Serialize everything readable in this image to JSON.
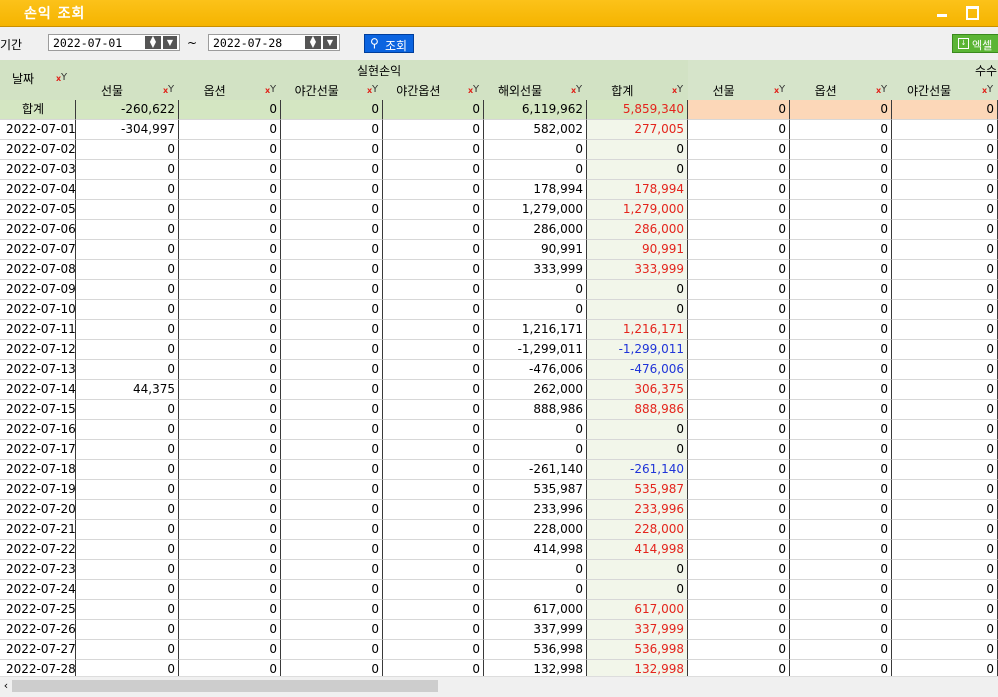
{
  "window": {
    "title": "손익 조회"
  },
  "toolbar": {
    "period_label": "기간",
    "date_from": "2022-07-01",
    "date_to": "2022-07-28",
    "tilde": "~",
    "search_label": "조회",
    "excel_label": "엑셀"
  },
  "grid": {
    "date_header": "날짜",
    "group_realized": "실현손익",
    "group_fee": "수수",
    "realized_columns": [
      "선물",
      "옵션",
      "야간선물",
      "야간옵션",
      "해외선물",
      "합계"
    ],
    "fee_columns": [
      "선물",
      "옵션",
      "야간선물"
    ],
    "summary": {
      "label": "합계",
      "values": [
        "-260,622",
        "0",
        "0",
        "0",
        "6,119,962",
        "5,859,340",
        "0",
        "0",
        "0"
      ]
    },
    "rows": [
      {
        "date": "2022-07-01",
        "values": [
          "-304,997",
          "0",
          "0",
          "0",
          "582,002",
          "277,005",
          "0",
          "0",
          "0"
        ]
      },
      {
        "date": "2022-07-02",
        "values": [
          "0",
          "0",
          "0",
          "0",
          "0",
          "0",
          "0",
          "0",
          "0"
        ]
      },
      {
        "date": "2022-07-03",
        "values": [
          "0",
          "0",
          "0",
          "0",
          "0",
          "0",
          "0",
          "0",
          "0"
        ]
      },
      {
        "date": "2022-07-04",
        "values": [
          "0",
          "0",
          "0",
          "0",
          "178,994",
          "178,994",
          "0",
          "0",
          "0"
        ]
      },
      {
        "date": "2022-07-05",
        "values": [
          "0",
          "0",
          "0",
          "0",
          "1,279,000",
          "1,279,000",
          "0",
          "0",
          "0"
        ]
      },
      {
        "date": "2022-07-06",
        "values": [
          "0",
          "0",
          "0",
          "0",
          "286,000",
          "286,000",
          "0",
          "0",
          "0"
        ]
      },
      {
        "date": "2022-07-07",
        "values": [
          "0",
          "0",
          "0",
          "0",
          "90,991",
          "90,991",
          "0",
          "0",
          "0"
        ]
      },
      {
        "date": "2022-07-08",
        "values": [
          "0",
          "0",
          "0",
          "0",
          "333,999",
          "333,999",
          "0",
          "0",
          "0"
        ]
      },
      {
        "date": "2022-07-09",
        "values": [
          "0",
          "0",
          "0",
          "0",
          "0",
          "0",
          "0",
          "0",
          "0"
        ]
      },
      {
        "date": "2022-07-10",
        "values": [
          "0",
          "0",
          "0",
          "0",
          "0",
          "0",
          "0",
          "0",
          "0"
        ]
      },
      {
        "date": "2022-07-11",
        "values": [
          "0",
          "0",
          "0",
          "0",
          "1,216,171",
          "1,216,171",
          "0",
          "0",
          "0"
        ]
      },
      {
        "date": "2022-07-12",
        "values": [
          "0",
          "0",
          "0",
          "0",
          "-1,299,011",
          "-1,299,011",
          "0",
          "0",
          "0"
        ]
      },
      {
        "date": "2022-07-13",
        "values": [
          "0",
          "0",
          "0",
          "0",
          "-476,006",
          "-476,006",
          "0",
          "0",
          "0"
        ]
      },
      {
        "date": "2022-07-14",
        "values": [
          "44,375",
          "0",
          "0",
          "0",
          "262,000",
          "306,375",
          "0",
          "0",
          "0"
        ]
      },
      {
        "date": "2022-07-15",
        "values": [
          "0",
          "0",
          "0",
          "0",
          "888,986",
          "888,986",
          "0",
          "0",
          "0"
        ]
      },
      {
        "date": "2022-07-16",
        "values": [
          "0",
          "0",
          "0",
          "0",
          "0",
          "0",
          "0",
          "0",
          "0"
        ]
      },
      {
        "date": "2022-07-17",
        "values": [
          "0",
          "0",
          "0",
          "0",
          "0",
          "0",
          "0",
          "0",
          "0"
        ]
      },
      {
        "date": "2022-07-18",
        "values": [
          "0",
          "0",
          "0",
          "0",
          "-261,140",
          "-261,140",
          "0",
          "0",
          "0"
        ]
      },
      {
        "date": "2022-07-19",
        "values": [
          "0",
          "0",
          "0",
          "0",
          "535,987",
          "535,987",
          "0",
          "0",
          "0"
        ]
      },
      {
        "date": "2022-07-20",
        "values": [
          "0",
          "0",
          "0",
          "0",
          "233,996",
          "233,996",
          "0",
          "0",
          "0"
        ]
      },
      {
        "date": "2022-07-21",
        "values": [
          "0",
          "0",
          "0",
          "0",
          "228,000",
          "228,000",
          "0",
          "0",
          "0"
        ]
      },
      {
        "date": "2022-07-22",
        "values": [
          "0",
          "0",
          "0",
          "0",
          "414,998",
          "414,998",
          "0",
          "0",
          "0"
        ]
      },
      {
        "date": "2022-07-23",
        "values": [
          "0",
          "0",
          "0",
          "0",
          "0",
          "0",
          "0",
          "0",
          "0"
        ]
      },
      {
        "date": "2022-07-24",
        "values": [
          "0",
          "0",
          "0",
          "0",
          "0",
          "0",
          "0",
          "0",
          "0"
        ]
      },
      {
        "date": "2022-07-25",
        "values": [
          "0",
          "0",
          "0",
          "0",
          "617,000",
          "617,000",
          "0",
          "0",
          "0"
        ]
      },
      {
        "date": "2022-07-26",
        "values": [
          "0",
          "0",
          "0",
          "0",
          "337,999",
          "337,999",
          "0",
          "0",
          "0"
        ]
      },
      {
        "date": "2022-07-27",
        "values": [
          "0",
          "0",
          "0",
          "0",
          "536,998",
          "536,998",
          "0",
          "0",
          "0"
        ]
      },
      {
        "date": "2022-07-28",
        "values": [
          "0",
          "0",
          "0",
          "0",
          "132,998",
          "132,998",
          "0",
          "0",
          "0"
        ]
      }
    ]
  },
  "colors": {
    "positive": "#e4241c",
    "negative": "#1f34d8",
    "accent": "#f5b400"
  }
}
